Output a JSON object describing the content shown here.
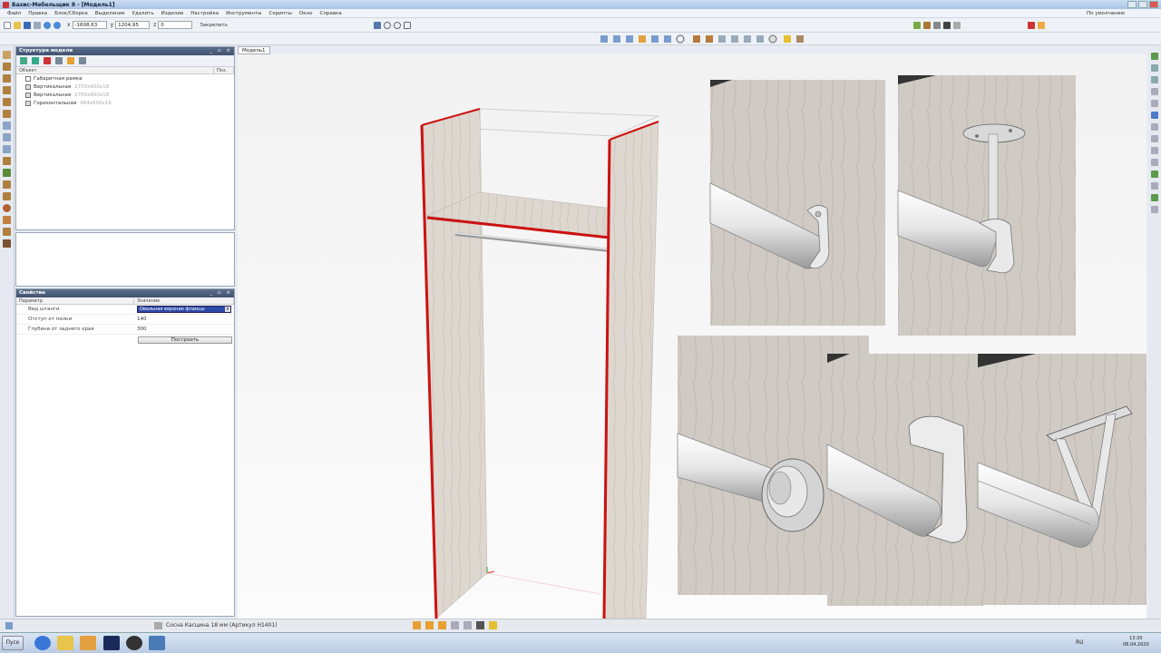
{
  "window": {
    "title": "Базис-Мебельщик 8 - [Модель1]"
  },
  "menu": {
    "items": [
      "Файл",
      "Правка",
      "Блок/Сборка",
      "Выделение",
      "Удалить",
      "Изделие",
      "Настройка",
      "Инструменты",
      "Скрипты",
      "Окно",
      "Справка"
    ],
    "right_label": "По умолчанию"
  },
  "coords": {
    "x_label": "x",
    "x_value": "-1608,63",
    "y_label": "y",
    "y_value": "1204,95",
    "z_label": "z",
    "z_value": "0",
    "fix_label": "Закрепить"
  },
  "doc_tab": "Модель1",
  "structure_panel": {
    "title": "Структура модели",
    "col_object": "Объект",
    "col_pos": "Поз.",
    "rows": [
      {
        "name": "Габаритная рамка",
        "size": ""
      },
      {
        "name": "Вертикальная",
        "size": "2700x600x18"
      },
      {
        "name": "Вертикальная",
        "size": "2700x600x18"
      },
      {
        "name": "Горизонтальная",
        "size": "964x600x18"
      }
    ]
  },
  "props_panel": {
    "title": "Свойства",
    "col_param": "Параметр",
    "col_value": "Значение",
    "rows": [
      {
        "name": "Вид штанги",
        "value": ""
      },
      {
        "name": "Отступ от полки",
        "value": "140"
      },
      {
        "name": "Глубина от заднего края",
        "value": "300"
      }
    ],
    "select_value": "Овальная верхние фланцы",
    "build_label": "Построить"
  },
  "status": {
    "material": "Сосна Касцина 18 мм (Артикул Н1401)"
  },
  "taskbar": {
    "start_label": "Пуск",
    "lang": "RU",
    "time": "13:30",
    "date": "08.04.2020"
  },
  "colors": {
    "board": "#ddd8d0",
    "board_edge": "#cc1111",
    "wall": "#cfcac3"
  }
}
